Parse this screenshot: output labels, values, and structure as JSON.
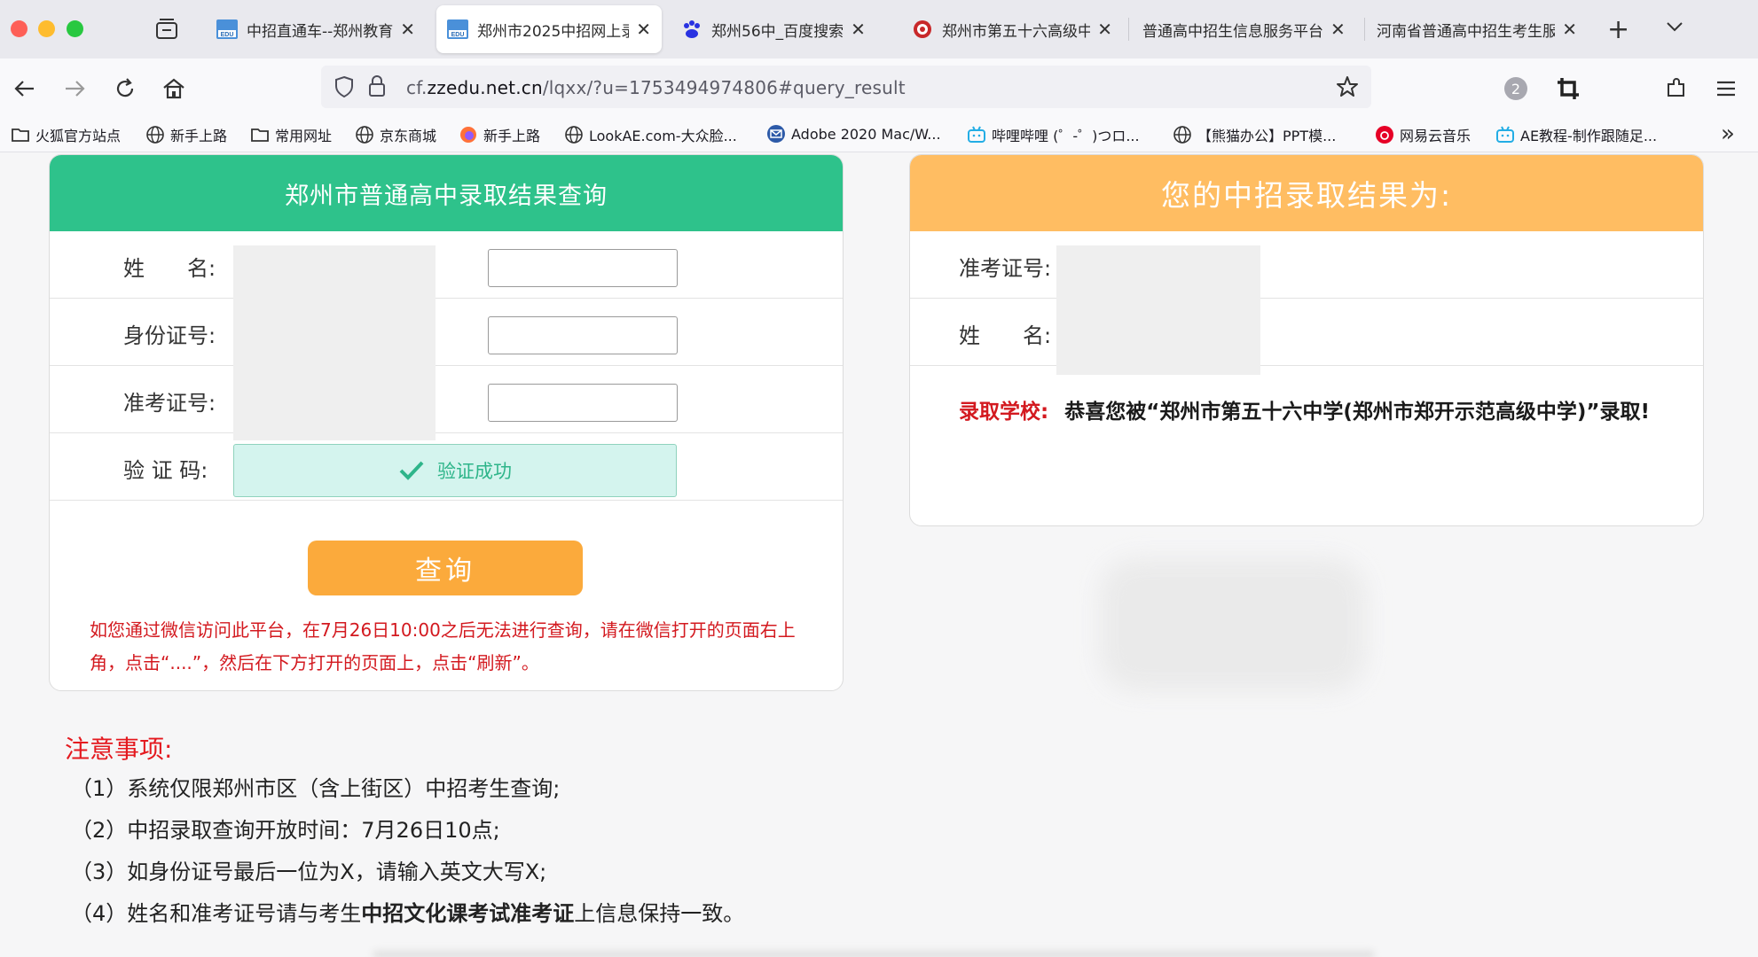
{
  "browser": {
    "tabs": [
      {
        "title": "中招直通车--郑州教育",
        "icon": "edu-favicon",
        "active": false
      },
      {
        "title": "郑州市2025中招网上录",
        "icon": "edu-favicon",
        "active": true
      },
      {
        "title": "郑州56中_百度搜索",
        "icon": "baidu-paw-icon",
        "active": false
      },
      {
        "title": "郑州市第五十六高级中",
        "icon": "school-seal-icon",
        "active": false
      },
      {
        "title": "普通高中招生信息服务平台",
        "icon": "none",
        "active": false
      },
      {
        "title": "河南省普通高中招生考生服",
        "icon": "none",
        "active": false
      }
    ],
    "tab_close_glyph": "✕",
    "new_tab_glyph": "+",
    "url_prefix": "cf.",
    "url_domain": "zzedu.net.cn",
    "url_path": "/lqxx/?u=1753494974806#query_result",
    "extension_badge": "2",
    "bookmarks": [
      {
        "label": "火狐官方站点",
        "icon": "folder-icon"
      },
      {
        "label": "新手上路",
        "icon": "globe-icon"
      },
      {
        "label": "常用网址",
        "icon": "folder-icon"
      },
      {
        "label": "京东商城",
        "icon": "globe-icon"
      },
      {
        "label": "新手上路",
        "icon": "firefox-icon"
      },
      {
        "label": "LookAE.com-大众脸...",
        "icon": "globe-icon"
      },
      {
        "label": "Adobe 2020 Mac/W...",
        "icon": "mail-icon"
      },
      {
        "label": "哔哩哔哩 (゜-゜)つロ...",
        "icon": "bilibili-icon"
      },
      {
        "label": "【熊猫办公】PPT模...",
        "icon": "globe-icon"
      },
      {
        "label": "网易云音乐",
        "icon": "netease-icon"
      },
      {
        "label": "AE教程-制作跟随足...",
        "icon": "bilibili-icon"
      }
    ],
    "more_bookmarks_glyph": "»"
  },
  "query_form": {
    "title": "郑州市普通高中录取结果查询",
    "name_label": "姓　　名:",
    "id_label": "身份证号:",
    "exam_no_label": "准考证号:",
    "captcha_label": "验  证  码:",
    "captcha_status": "验证成功",
    "submit_label": "查询",
    "wechat_note": "如您通过微信访问此平台，在7月26日10:00之后无法进行查询，请在微信打开的页面右上角，点击“....”，然后在下方打开的页面上，点击“刷新”。"
  },
  "result_panel": {
    "title": "您的中招录取结果为:",
    "exam_no_label": "准考证号:",
    "name_label": "姓　　名:",
    "school_label": "录取学校:",
    "school_message": "恭喜您被“郑州市第五十六中学(郑州市郑开示范高级中学)”录取!"
  },
  "notice": {
    "title": "注意事项:",
    "items": [
      {
        "prefix": "（1）",
        "text": "系统仅限郑州市区（含上街区）中招考生查询;"
      },
      {
        "prefix": "（2）",
        "text": "中招录取查询开放时间：7月26日10点;"
      },
      {
        "prefix": "（3）",
        "text": "如身份证号最后一位为X，请输入英文大写X;"
      },
      {
        "prefix": "（4）",
        "text_before": "姓名和准考证号请与考生",
        "text_bold": "中招文化课考试准考证",
        "text_after": "上信息保持一致。"
      }
    ]
  },
  "colors": {
    "green_header": "#2ec28b",
    "orange_header": "#ffbd62",
    "query_button": "#fbaa3c",
    "notice_red": "#e4191f"
  }
}
